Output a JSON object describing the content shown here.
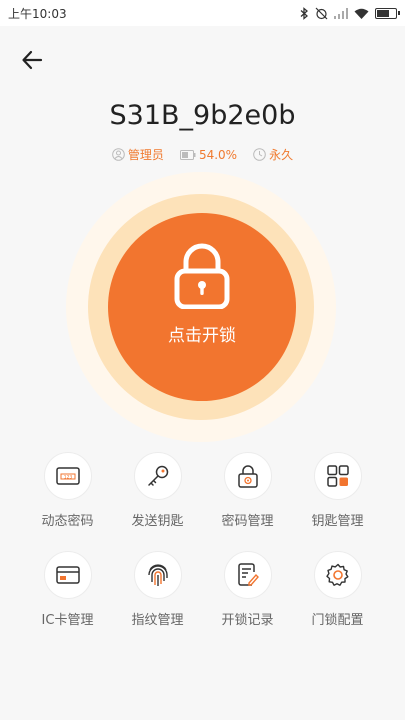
{
  "status_bar": {
    "time": "上午10:03"
  },
  "device": {
    "name": "S31B_9b2e0b"
  },
  "info": {
    "role": "管理员",
    "battery": "54.0%",
    "validity": "永久"
  },
  "unlock": {
    "label": "点击开锁"
  },
  "features": [
    {
      "label": "动态密码",
      "icon": "dynamic-password-icon"
    },
    {
      "label": "发送钥匙",
      "icon": "send-key-icon"
    },
    {
      "label": "密码管理",
      "icon": "password-management-icon"
    },
    {
      "label": "钥匙管理",
      "icon": "key-management-icon"
    },
    {
      "label": "IC卡管理",
      "icon": "ic-card-icon"
    },
    {
      "label": "指纹管理",
      "icon": "fingerprint-icon"
    },
    {
      "label": "开锁记录",
      "icon": "unlock-record-icon"
    },
    {
      "label": "门锁配置",
      "icon": "lock-config-icon"
    }
  ],
  "colors": {
    "accent": "#f2752f",
    "halo": "#fde2b9",
    "info_text": "#f07a2f"
  }
}
